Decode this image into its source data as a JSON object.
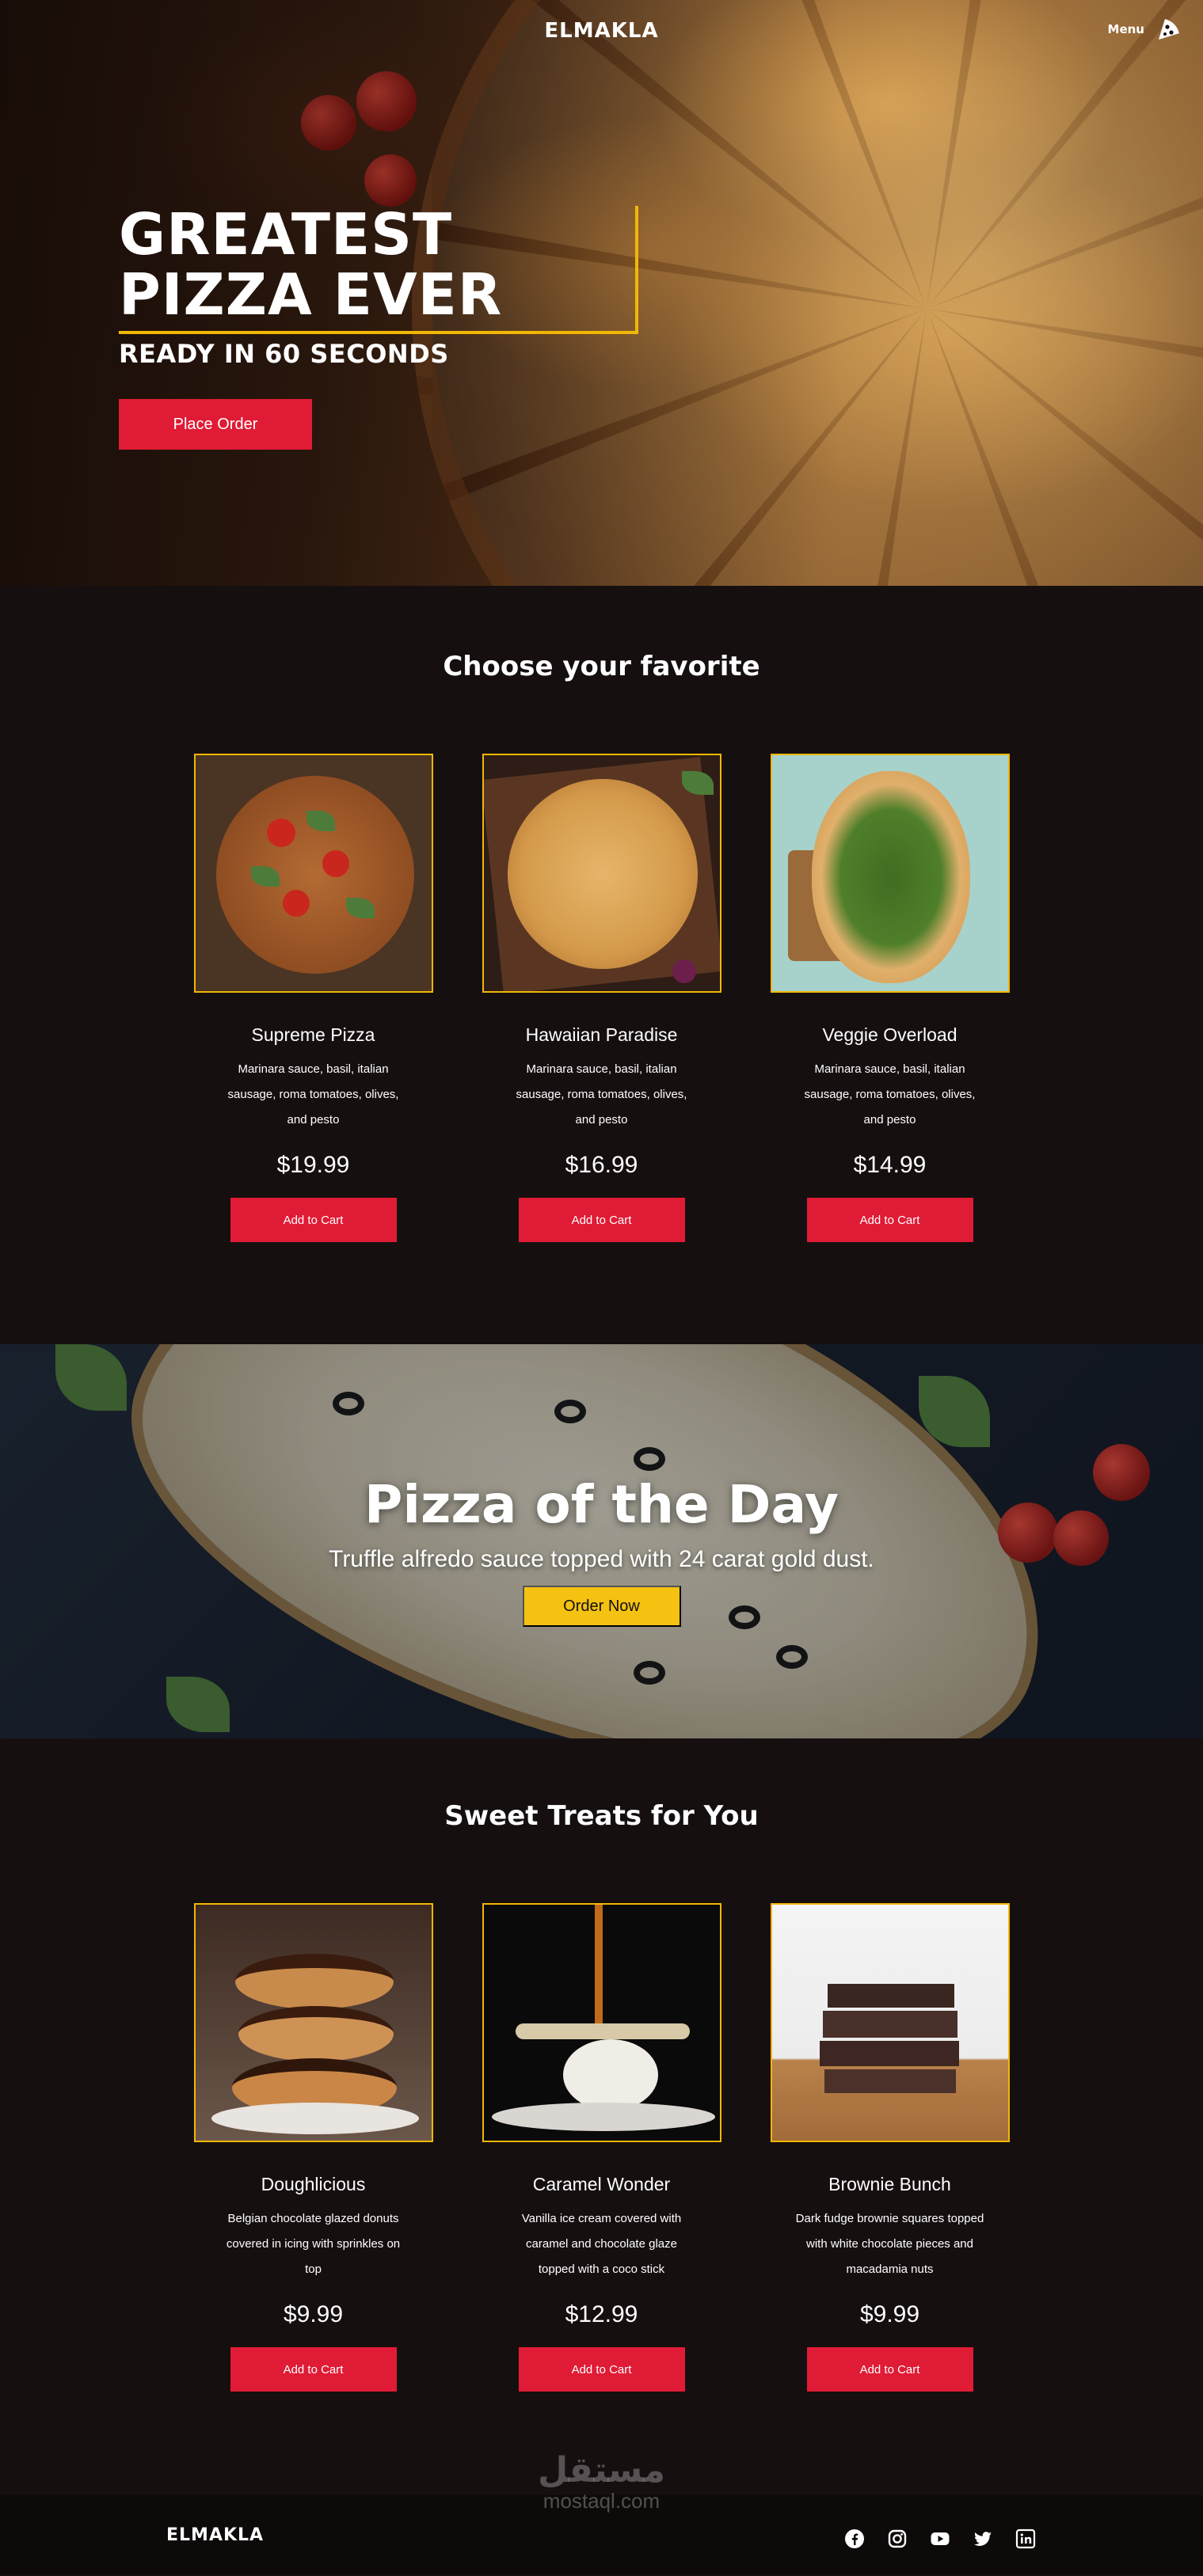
{
  "brand": "ELMAKLA",
  "nav": {
    "menu_label": "Menu",
    "menu_icon": "pizza-slice-icon"
  },
  "hero": {
    "title_line1": "GREATEST",
    "title_line2": "PIZZA EVER",
    "subtitle": "READY IN 60 SECONDS",
    "cta_label": "Place Order"
  },
  "favorites": {
    "title": "Choose your favorite",
    "items": [
      {
        "name": "Supreme Pizza",
        "description": "Marinara sauce, basil, italian sausage, roma tomatoes, olives, and pesto",
        "price": "$19.99",
        "button": "Add to Cart"
      },
      {
        "name": "Hawaiian Paradise",
        "description": "Marinara sauce, basil, italian sausage, roma tomatoes, olives, and pesto",
        "price": "$16.99",
        "button": "Add to Cart"
      },
      {
        "name": "Veggie Overload",
        "description": "Marinara sauce, basil, italian sausage, roma tomatoes, olives, and pesto",
        "price": "$14.99",
        "button": "Add to Cart"
      }
    ]
  },
  "pizza_of_day": {
    "title": "Pizza of the Day",
    "description": "Truffle alfredo sauce topped with 24 carat gold dust.",
    "button": "Order Now"
  },
  "sweets": {
    "title": "Sweet Treats for You",
    "items": [
      {
        "name": "Doughlicious",
        "description": "Belgian chocolate glazed donuts covered in icing with sprinkles on top",
        "price": "$9.99",
        "button": "Add to Cart"
      },
      {
        "name": "Caramel Wonder",
        "description": "Vanilla ice cream covered with caramel and chocolate glaze topped with a coco stick",
        "price": "$12.99",
        "button": "Add to Cart"
      },
      {
        "name": "Brownie Bunch",
        "description": "Dark fudge brownie squares topped with white chocolate pieces and macadamia nuts",
        "price": "$9.99",
        "button": "Add to Cart"
      }
    ]
  },
  "footer": {
    "brand": "ELMAKLA",
    "social": [
      "facebook-icon",
      "instagram-icon",
      "youtube-icon",
      "twitter-icon",
      "linkedin-icon"
    ],
    "watermark_ar": "مستقل",
    "watermark_en": "mostaql.com"
  },
  "colors": {
    "accent_red": "#e01b35",
    "accent_yellow": "#f2b705",
    "button_yellow": "#f5c211",
    "background": "#160f10"
  }
}
